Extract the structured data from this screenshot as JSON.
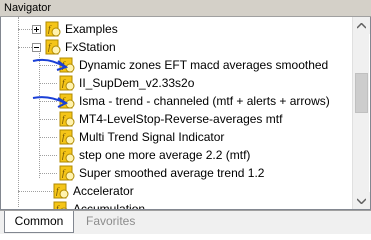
{
  "window": {
    "title": "Navigator"
  },
  "tree": {
    "items": [
      {
        "label": "Examples",
        "kind": "folder",
        "state": "collapsed"
      },
      {
        "label": "FxStation",
        "kind": "folder",
        "state": "expanded"
      },
      {
        "label": "Dynamic zones EFT macd averages smoothed",
        "kind": "indicator"
      },
      {
        "label": "II_SupDem_v2.33s2o",
        "kind": "indicator"
      },
      {
        "label": "Isma - trend - channeled (mtf + alerts + arrows)",
        "kind": "indicator"
      },
      {
        "label": "MT4-LevelStop-Reverse-averages mtf",
        "kind": "indicator"
      },
      {
        "label": "Multi Trend Signal Indicator",
        "kind": "indicator"
      },
      {
        "label": "step one more average 2.2 (mtf)",
        "kind": "indicator"
      },
      {
        "label": "Super smoothed average trend 1.2",
        "kind": "indicator"
      },
      {
        "label": "Accelerator",
        "kind": "indicator"
      },
      {
        "label": "Accumulation",
        "kind": "indicator"
      }
    ]
  },
  "tabs": [
    {
      "label": "Common",
      "active": true
    },
    {
      "label": "Favorites",
      "active": false
    }
  ],
  "icons": {
    "indicator": "script-f-icon",
    "expander_collapsed": "plus-expander-icon",
    "expander_expanded": "minus-expander-icon"
  },
  "colors": {
    "title_bar": "#d4d0c8",
    "icon_yellow": "#f5c518",
    "annotation_blue": "#1a3fd6",
    "inactive_tab_text": "#8c8c8c"
  }
}
